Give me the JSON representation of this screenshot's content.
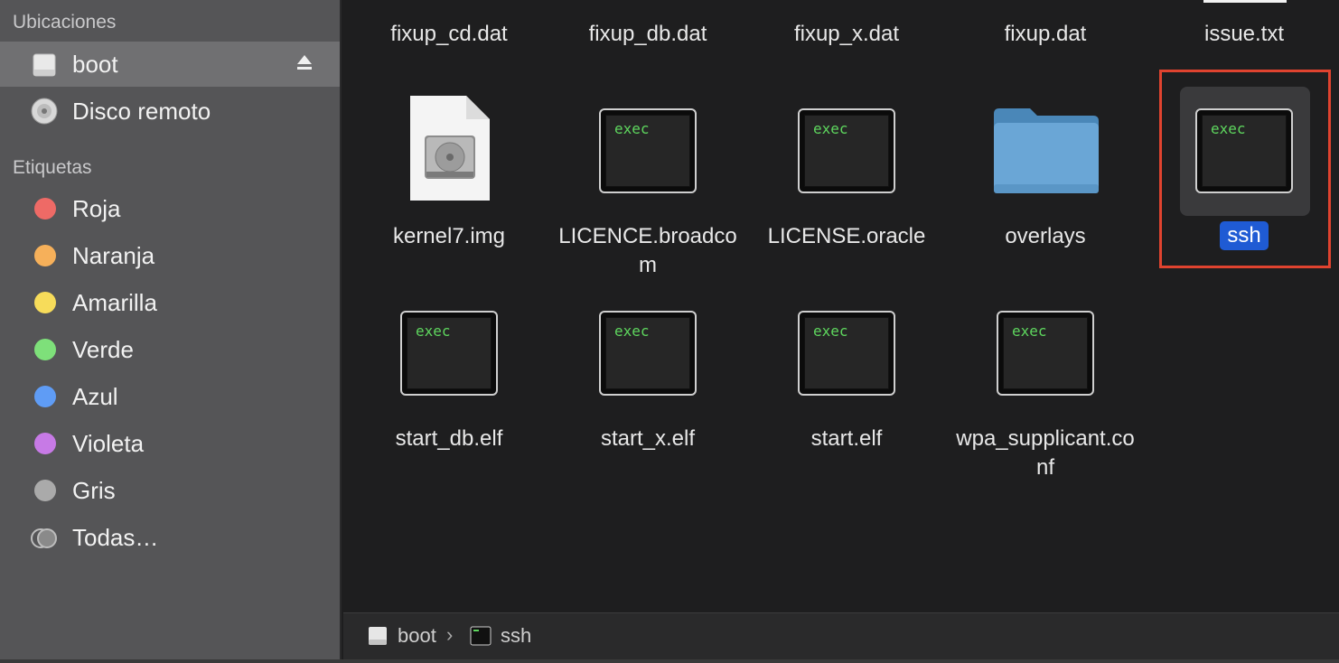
{
  "sidebar": {
    "locations_title": "Ubicaciones",
    "locations": [
      {
        "label": "boot",
        "icon": "drive-icon",
        "selected": true,
        "eject_icon": "eject-icon"
      },
      {
        "label": "Disco remoto",
        "icon": "disc-icon"
      }
    ],
    "tags_title": "Etiquetas",
    "tags": [
      {
        "label": "Roja",
        "color": "#ee6a66"
      },
      {
        "label": "Naranja",
        "color": "#f6b05a"
      },
      {
        "label": "Amarilla",
        "color": "#f7dc5a"
      },
      {
        "label": "Verde",
        "color": "#7ee07a"
      },
      {
        "label": "Azul",
        "color": "#5f9cf5"
      },
      {
        "label": "Violeta",
        "color": "#c77ae6"
      },
      {
        "label": "Gris",
        "color": "#aaaaaa"
      },
      {
        "label": "Todas…",
        "icon": "all-tags-icon"
      }
    ]
  },
  "files": {
    "row0": [
      "fixup_cd.dat",
      "fixup_db.dat",
      "fixup_x.dat",
      "fixup.dat",
      "issue.txt"
    ],
    "row1": [
      {
        "name": "kernel7.img",
        "icon": "disk-image-icon"
      },
      {
        "name": "LICENCE.broadcom",
        "icon_text": "exec"
      },
      {
        "name": "LICENSE.oracle",
        "icon_text": "exec"
      },
      {
        "name": "overlays",
        "icon": "folder-icon"
      },
      {
        "name": "ssh",
        "icon_text": "exec",
        "selected": true
      }
    ],
    "row2": [
      {
        "name": "start_db.elf",
        "icon_text": "exec"
      },
      {
        "name": "start_x.elf",
        "icon_text": "exec"
      },
      {
        "name": "start.elf",
        "icon_text": "exec"
      },
      {
        "name": "wpa_supplicant.conf",
        "icon_text": "exec"
      }
    ]
  },
  "pathbar": {
    "crumbs": [
      "boot",
      "ssh"
    ],
    "separator": "›"
  },
  "colors": {
    "selection": "#1f5bd4",
    "highlight_box": "#e0432f",
    "exec_text": "#5ed65e"
  }
}
